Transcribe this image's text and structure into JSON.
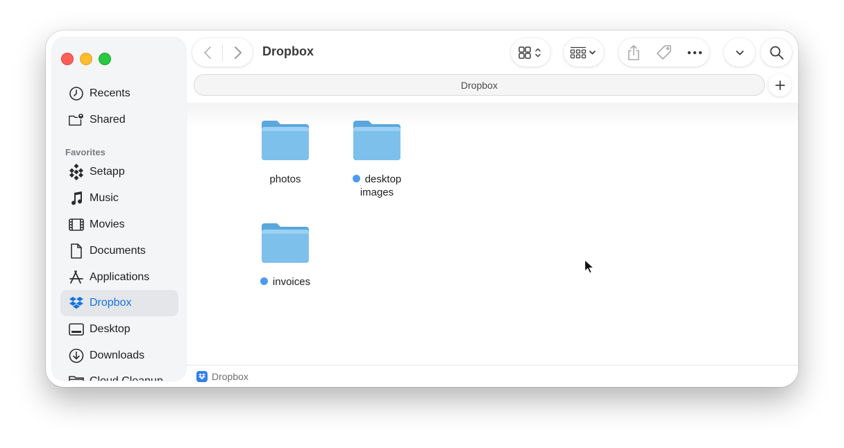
{
  "window": {
    "title": "Dropbox"
  },
  "sidebar": {
    "top_items": [
      {
        "label": "Recents",
        "icon": "clock-icon"
      },
      {
        "label": "Shared",
        "icon": "shared-folder-icon"
      }
    ],
    "favorites_header": "Favorites",
    "favorites": [
      {
        "label": "Setapp",
        "icon": "setapp-icon"
      },
      {
        "label": "Music",
        "icon": "music-note-icon"
      },
      {
        "label": "Movies",
        "icon": "film-icon"
      },
      {
        "label": "Documents",
        "icon": "document-icon"
      },
      {
        "label": "Applications",
        "icon": "applications-icon"
      },
      {
        "label": "Dropbox",
        "icon": "dropbox-icon",
        "selected": true
      },
      {
        "label": "Desktop",
        "icon": "desktop-icon"
      },
      {
        "label": "Downloads",
        "icon": "download-icon"
      },
      {
        "label": "Cloud Cleanup...",
        "icon": "folder-icon"
      }
    ]
  },
  "pathbar": {
    "label": "Dropbox"
  },
  "files": [
    {
      "name": "photos",
      "tagged": false
    },
    {
      "name": "desktop images",
      "tagged": true,
      "tag_color": "#4c9bf0"
    },
    {
      "name": "invoices",
      "tagged": true,
      "tag_color": "#4c9bf0"
    }
  ],
  "statusbar": {
    "location": "Dropbox"
  },
  "colors": {
    "accent": "#1573de",
    "tag_blue": "#4c9bf0",
    "folder": "#6fb6e6"
  }
}
